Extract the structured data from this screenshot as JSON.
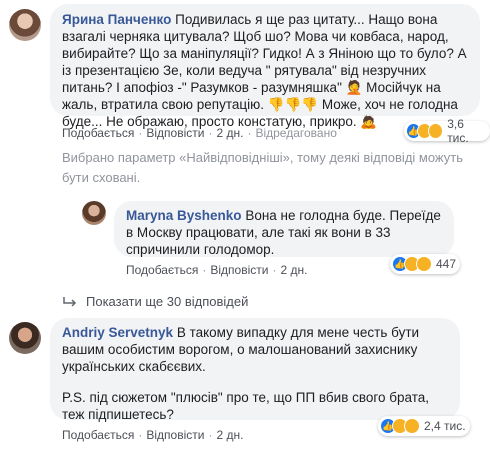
{
  "comments": [
    {
      "author": "Ярина Панченко",
      "text": "Подивилась я ще раз цитату... Нащо вона взагалі черняка цитувала? Щоб шо? Мова чи ковбаса, народ, вибирайте? Що за маніпуляції? Гидко! А з Яніною що то було? А із презентацією Зе, коли ведуча \" рятувала\" від незручних питань? І апофіоз -\" Разумков - разумняшка\" 🤦 Мосійчук на жаль, втратила свою репутацію. 👎👎👎 Може, хоч не голодна буде... Не ображаю, просто констатую, прикро. 🙇",
      "like": "Подобається",
      "reply": "Відповісти",
      "time": "2 дн.",
      "edited": "Відредаговано",
      "reactions_count": "3,6 тис."
    },
    {
      "author": "Maryna Byshenko",
      "text": "Вона не голодна буде. Переїде в Москву працювати, але такі як вони в 33 спричинили голодомор.",
      "like": "Подобається",
      "reply": "Відповісти",
      "time": "2 дн.",
      "reactions_count": "447"
    },
    {
      "author": "Andriy Servetnyk",
      "text": "В такому випадку для мене честь бути вашим особистим ворогом, о малошанований захиснику українських скабєєвих.",
      "text2": "P.S. під сюжетом \"плюсів\" про те, що ПП вбив свого брата, теж підпишетесь?",
      "like": "Подобається",
      "reply": "Відповісти",
      "time": "2 дн.",
      "reactions_count": "2,4 тис."
    }
  ],
  "notice": "Вибрано параметр «Найвідповідніші», тому деякі відповіді можуть бути сховані.",
  "show_more": "Показати ще 30 відповідей",
  "colors": {
    "link": "#385898",
    "bubble": "#f2f3f5",
    "like": "#1877f2",
    "emoji": "#f7b125"
  }
}
